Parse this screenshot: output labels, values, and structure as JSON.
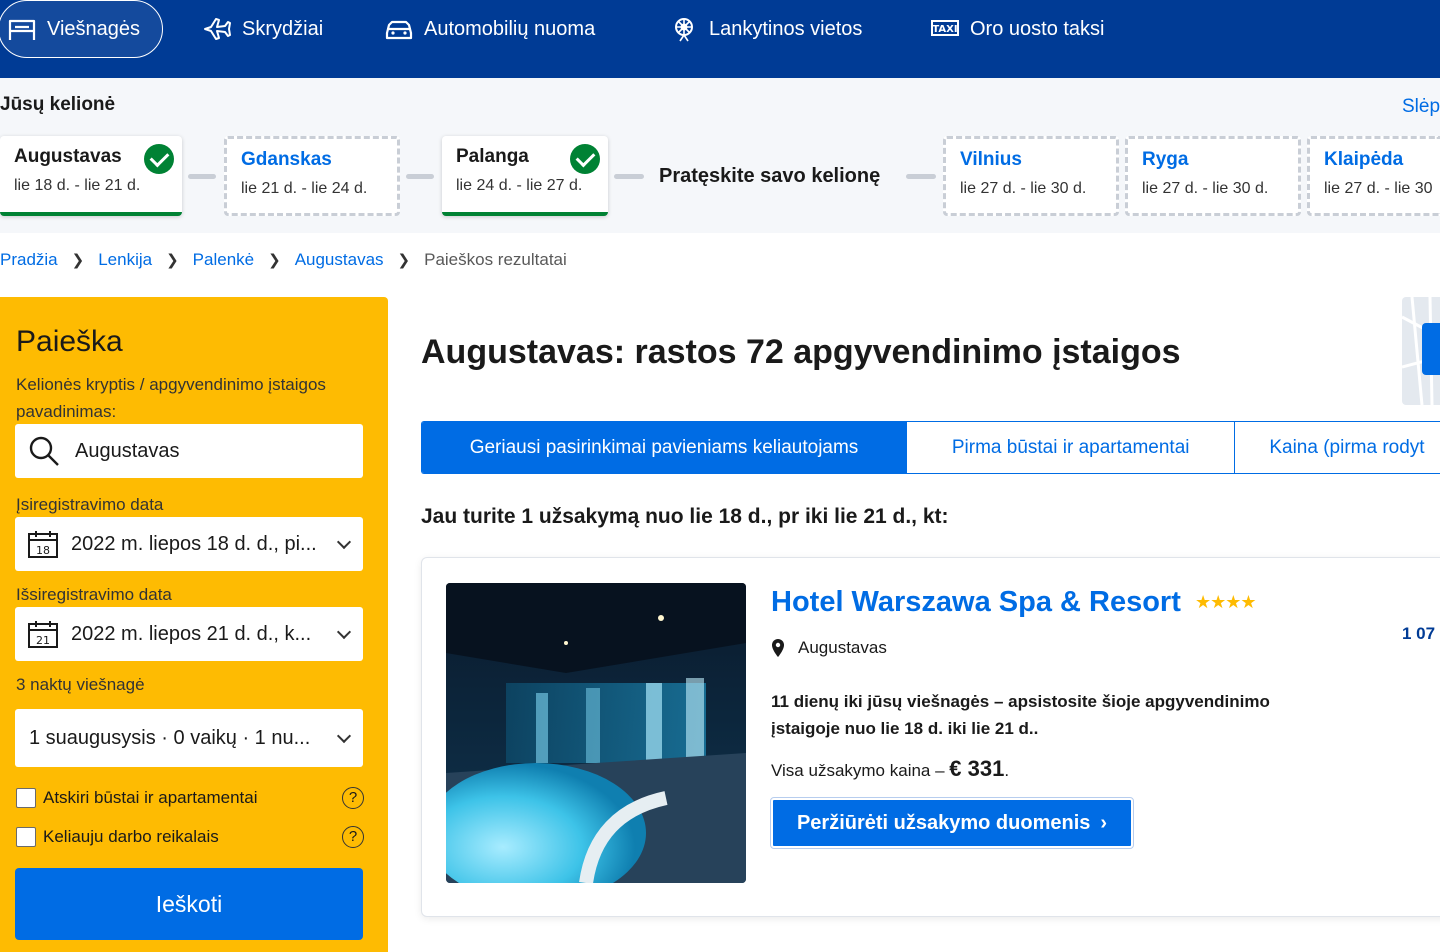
{
  "nav": {
    "items": [
      {
        "label": "Viešnagės",
        "icon": "bed-icon",
        "active": true
      },
      {
        "label": "Skrydžiai",
        "icon": "plane-icon"
      },
      {
        "label": "Automobilių nuoma",
        "icon": "car-icon"
      },
      {
        "label": "Lankytinos vietos",
        "icon": "attractions-icon"
      },
      {
        "label": "Oro uosto taksi",
        "icon": "taxi-icon"
      }
    ]
  },
  "trip": {
    "title": "Jūsų kelionė",
    "hide_label": "Slėp",
    "extend_label": "Pratęskite savo kelionę",
    "stops": [
      {
        "city": "Augustavas",
        "dates": "lie 18 d. - lie 21 d.",
        "booked": true
      },
      {
        "city": "Gdanskas",
        "dates": "lie 21 d. - lie 24 d.",
        "booked": false
      },
      {
        "city": "Palanga",
        "dates": "lie 24 d. - lie 27 d.",
        "booked": true
      }
    ],
    "suggestions": [
      {
        "city": "Vilnius",
        "dates": "lie 27 d. - lie 30 d."
      },
      {
        "city": "Ryga",
        "dates": "lie 27 d. - lie 30 d."
      },
      {
        "city": "Klaipėda",
        "dates": "lie 27 d. - lie 30"
      }
    ]
  },
  "breadcrumb": {
    "items": [
      "Pradžia",
      "Lenkija",
      "Palenkė",
      "Augustavas"
    ],
    "current": "Paieškos rezultatai"
  },
  "search": {
    "title": "Paieška",
    "destination_label": "Kelionės kryptis / apgyvendinimo įstaigos pavadinimas:",
    "destination_value": "Augustavas",
    "checkin_label": "Įsiregistravimo data",
    "checkin_value": "2022 m. liepos 18 d. d., pi...",
    "checkin_day": "18",
    "checkout_label": "Išsiregistravimo data",
    "checkout_value": "2022 m. liepos 21 d. d., k...",
    "checkout_day": "21",
    "nights_label": "3 naktų viešnagė",
    "guests_value": "1 suaugusysis · 0 vaikų · 1 nu...",
    "checkbox_apartments": "Atskiri būstai ir apartamentai",
    "checkbox_business": "Keliauju darbo reikalais",
    "help_glyph": "?",
    "button_label": "Ieškoti"
  },
  "results": {
    "heading": "Augustavas: rastos 72 apgyvendinimo įstaigos",
    "tabs": [
      {
        "label": "Geriausi pasirinkimai pavieniams keliautojams",
        "active": true
      },
      {
        "label": "Pirma būstai ir apartamentai"
      },
      {
        "label": "Kaina (pirma rodyt"
      }
    ],
    "notice": "Jau turite 1 užsakymą nuo lie 18 d., pr iki lie 21 d., kt:"
  },
  "booking": {
    "hotel_name": "Hotel Warszawa Spa & Resort",
    "stars": "★★★★",
    "star_count": 4,
    "location": "Augustavas",
    "right_price": "1 07",
    "info": "11 dienų iki jūsų viešnagės – apsistosite šioje apgyvendinimo įstaigoje nuo lie 18 d. iki lie 21 d..",
    "total_label": "Visa užsakymo kaina –",
    "total_value": "€ 331",
    "total_suffix": ".",
    "button_label": "Peržiūrėti užsakymo duomenis",
    "button_chevron": "›"
  },
  "colors": {
    "brand_dark": "#003b95",
    "accent": "#006ce4",
    "yellow": "#febb02",
    "success": "#008234"
  }
}
